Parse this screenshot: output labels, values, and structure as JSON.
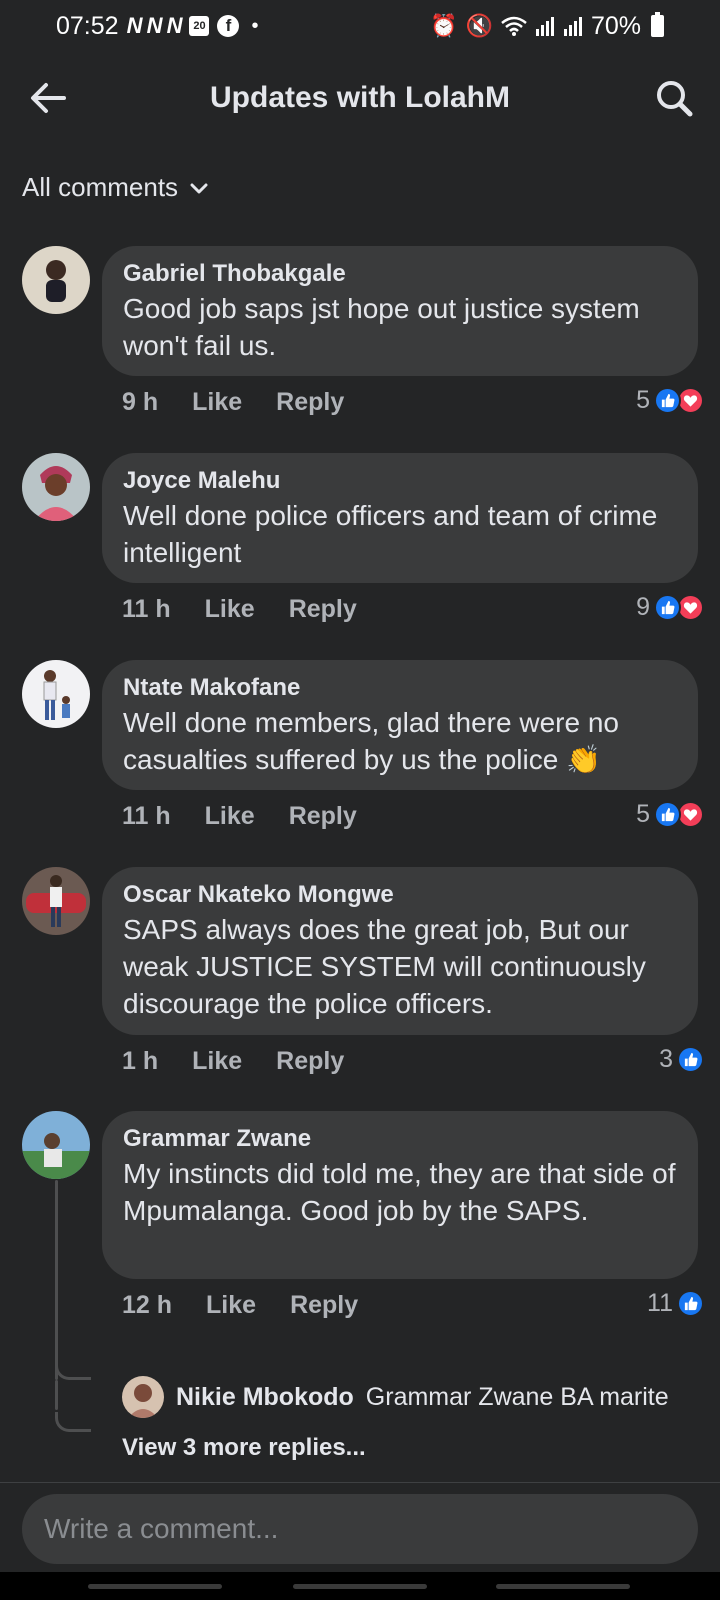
{
  "status_bar": {
    "time": "07:52",
    "notif_letters": "N N N",
    "calendar_day": "20",
    "battery": "70%"
  },
  "header": {
    "title": "Updates with LolahM",
    "back_icon": "arrow-left-icon",
    "search_icon": "search-icon"
  },
  "filter": {
    "label": "All comments"
  },
  "comments": [
    {
      "name": "Gabriel Thobakgale",
      "text": "Good job saps jst hope out justice system won't fail us.",
      "time": "9 h",
      "like": "Like",
      "reply": "Reply",
      "reactions": "5",
      "reaction_types": [
        "like",
        "love"
      ],
      "avatar_color": "#c9b89b"
    },
    {
      "name": "Joyce Malehu",
      "text": "Well done police officers and team of crime intelligent",
      "time": "11 h",
      "like": "Like",
      "reply": "Reply",
      "reactions": "9",
      "reaction_types": [
        "like",
        "love"
      ],
      "avatar_color": "#9c4a5a"
    },
    {
      "name": "Ntate Makofane",
      "text": "Well done members, glad there were no casualties suffered by us the police",
      "emoji": "👏",
      "time": "11 h",
      "like": "Like",
      "reply": "Reply",
      "reactions": "5",
      "reaction_types": [
        "like",
        "love"
      ],
      "avatar_color": "#e8e8ea"
    },
    {
      "name": "Oscar Nkateko Mongwe",
      "text": "SAPS always does the great job,  But our weak JUSTICE SYSTEM will continuously discourage the police officers.",
      "time": "1 h",
      "like": "Like",
      "reply": "Reply",
      "reactions": "3",
      "reaction_types": [
        "like"
      ],
      "avatar_color": "#8a3a3a"
    },
    {
      "name": "Grammar Zwane",
      "text": "My instincts did told me, they are that side of Mpumalanga. Good job by the SAPS.",
      "time": "12 h",
      "like": "Like",
      "reply": "Reply",
      "reactions": "11",
      "reaction_types": [
        "like"
      ],
      "avatar_color": "#6a9ac8"
    }
  ],
  "reply_preview": {
    "name": "Nikie Mbokodo",
    "text": "Grammar Zwane BA marite",
    "avatar_color": "#c8a890"
  },
  "more_replies": "View 3 more replies...",
  "composer": {
    "placeholder": "Write a comment..."
  }
}
